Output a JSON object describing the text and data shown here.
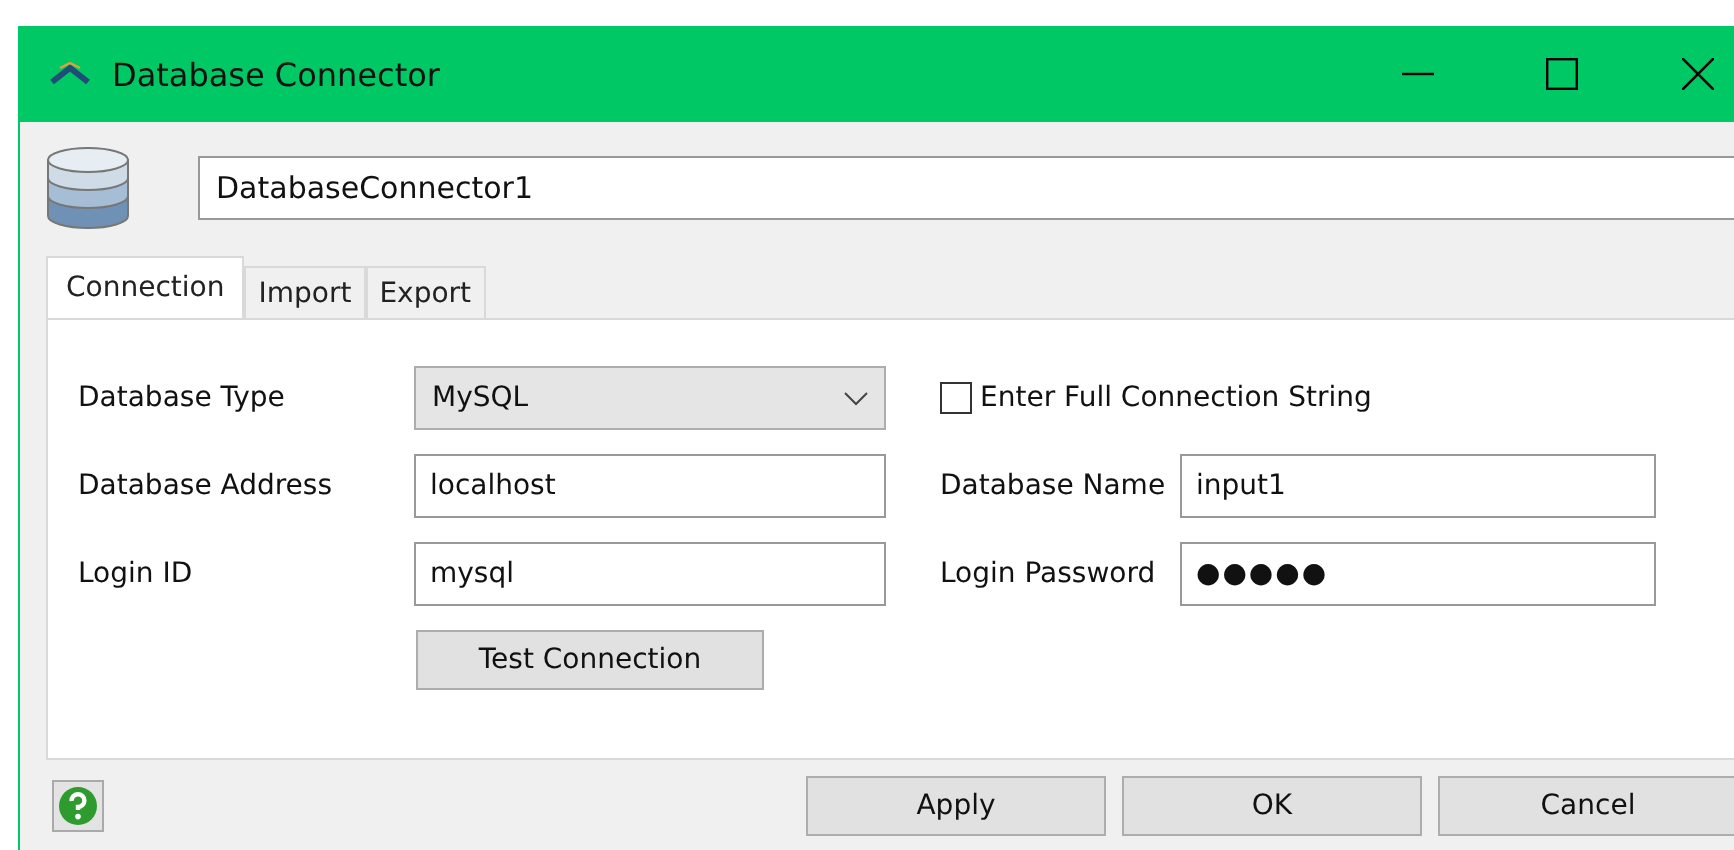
{
  "window": {
    "title": "Database Connector"
  },
  "name_field": {
    "value": "DatabaseConnector1"
  },
  "tabs": [
    {
      "label": "Connection",
      "selected": true
    },
    {
      "label": "Import",
      "selected": false
    },
    {
      "label": "Export",
      "selected": false
    }
  ],
  "connection": {
    "database_type": {
      "label": "Database Type",
      "value": "MySQL"
    },
    "full_string": {
      "label": "Enter Full Connection String",
      "checked": false
    },
    "database_address": {
      "label": "Database Address",
      "value": "localhost"
    },
    "database_name": {
      "label": "Database Name",
      "value": "input1"
    },
    "login_id": {
      "label": "Login ID",
      "value": "mysql"
    },
    "login_password": {
      "label": "Login Password",
      "value": "●●●●●"
    },
    "test_button": "Test Connection"
  },
  "buttons": [
    "Apply",
    "OK",
    "Cancel"
  ]
}
